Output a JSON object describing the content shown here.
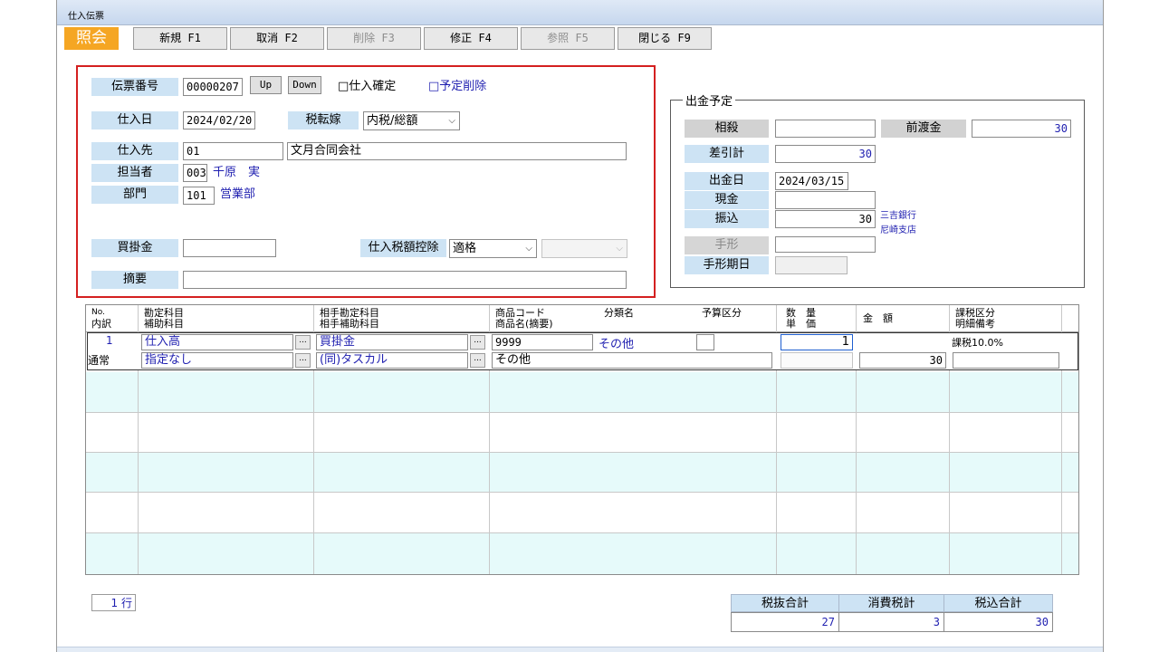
{
  "window": {
    "title": "仕入伝票"
  },
  "mode_badge": "照会",
  "toolbar": [
    {
      "label": "新規 F1",
      "enabled": true
    },
    {
      "label": "取消 F2",
      "enabled": true
    },
    {
      "label": "削除 F3",
      "enabled": false
    },
    {
      "label": "修正 F4",
      "enabled": true
    },
    {
      "label": "参照 F5",
      "enabled": false
    },
    {
      "label": "閉じる F9",
      "enabled": true
    }
  ],
  "header": {
    "slip_no_label": "伝票番号",
    "slip_no": "00000207",
    "up_label": "Up",
    "down_label": "Down",
    "confirm_label": "□仕入確定",
    "schedule_delete_label": "□予定削除",
    "date_label": "仕入日",
    "date": "2024/02/20",
    "tax_label": "税転嫁",
    "tax_value": "内税/総額",
    "supplier_label": "仕入先",
    "supplier_code": "01",
    "supplier_name": "文月合同会社",
    "staff_label": "担当者",
    "staff_code": "003",
    "staff_name": "千原　実",
    "dept_label": "部門",
    "dept_code": "101",
    "dept_name": "営業部",
    "payable_label": "買掛金",
    "payable_value": "",
    "deduct_label": "仕入税額控除",
    "deduct_value": "適格",
    "deduct_sub_value": "",
    "memo_label": "摘要",
    "memo_value": ""
  },
  "payment": {
    "legend": "出金予定",
    "offset_label": "相殺",
    "offset_value": "",
    "advance_label": "前渡金",
    "advance_value": "30",
    "net_label": "差引計",
    "net_value": "30",
    "pay_date_label": "出金日",
    "pay_date": "2024/03/15",
    "cash_label": "現金",
    "cash_value": "",
    "transfer_label": "振込",
    "transfer_value": "30",
    "bank_name": "三吉銀行",
    "branch_name": "尼崎支店",
    "bill_label": "手形",
    "bill_value": "",
    "bill_due_label": "手形期日",
    "bill_due_value": ""
  },
  "grid": {
    "headers": {
      "no": "No.",
      "breakdown": "内訳",
      "account": "勘定科目",
      "sub_account": "補助科目",
      "counter_account": "相手勘定科目",
      "counter_sub": "相手補助科目",
      "product_code": "商品コード",
      "product_name": "商品名(摘要)",
      "category": "分類名",
      "budget": "予算区分",
      "qty": "数　量",
      "unit_price": "単　価",
      "amount": "金　額",
      "tax_class": "課税区分",
      "detail_note": "明細備考"
    },
    "row": {
      "no": "1",
      "breakdown": "通常",
      "account": "仕入高",
      "sub_account": "指定なし",
      "counter_account": "買掛金",
      "counter_sub": "(同)タスカル",
      "product_code": "9999",
      "category": "その他",
      "product_name": "その他",
      "qty": "1",
      "unit_price": "",
      "amount": "30",
      "tax_class": "課税10.0%",
      "detail_note": ""
    }
  },
  "row_count": "1 行",
  "totals": {
    "excl_label": "税抜合計",
    "excl_value": "27",
    "tax_label": "消費税計",
    "tax_value": "3",
    "incl_label": "税込合計",
    "incl_value": "30"
  },
  "colors": {
    "accent_orange": "#f5a623",
    "label_blue": "#cde3f4",
    "value_blue": "#1f1fb0",
    "highlight_red": "#d42020",
    "grid_band": "#e6fafa"
  }
}
